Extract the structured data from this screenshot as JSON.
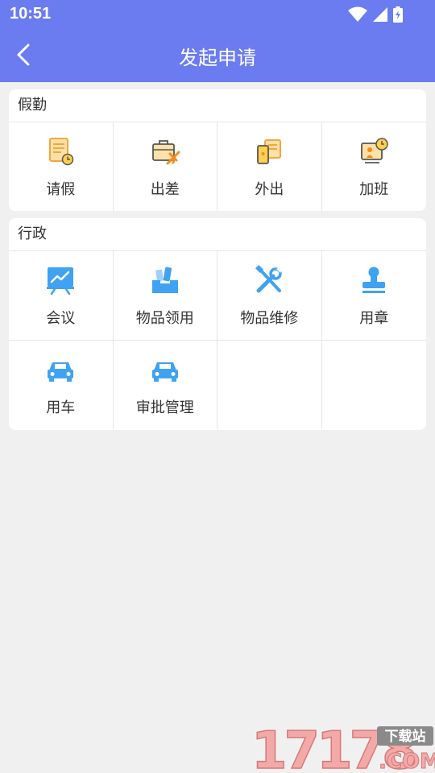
{
  "status_bar": {
    "time": "10:51"
  },
  "header": {
    "title": "发起申请"
  },
  "sections": [
    {
      "title": "假勤",
      "items": [
        {
          "label": "请假",
          "icon": "leave-note-icon"
        },
        {
          "label": "出差",
          "icon": "briefcase-plane-icon"
        },
        {
          "label": "外出",
          "icon": "phone-list-icon"
        },
        {
          "label": "加班",
          "icon": "overtime-clock-icon"
        }
      ]
    },
    {
      "title": "行政",
      "items": [
        {
          "label": "会议",
          "icon": "presentation-board-icon"
        },
        {
          "label": "物品领用",
          "icon": "supplies-box-icon"
        },
        {
          "label": "物品维修",
          "icon": "repair-tools-icon"
        },
        {
          "label": "用章",
          "icon": "stamp-icon"
        },
        {
          "label": "用车",
          "icon": "car-icon"
        },
        {
          "label": "审批管理",
          "icon": "car-icon"
        }
      ]
    }
  ],
  "watermark": {
    "number": "17178",
    "domain": ".COM",
    "tag": "下载站"
  },
  "colors": {
    "primary": "#6b7cf0",
    "icon_blue": "#3fa2f2",
    "icon_orange": "#f7a93b"
  }
}
